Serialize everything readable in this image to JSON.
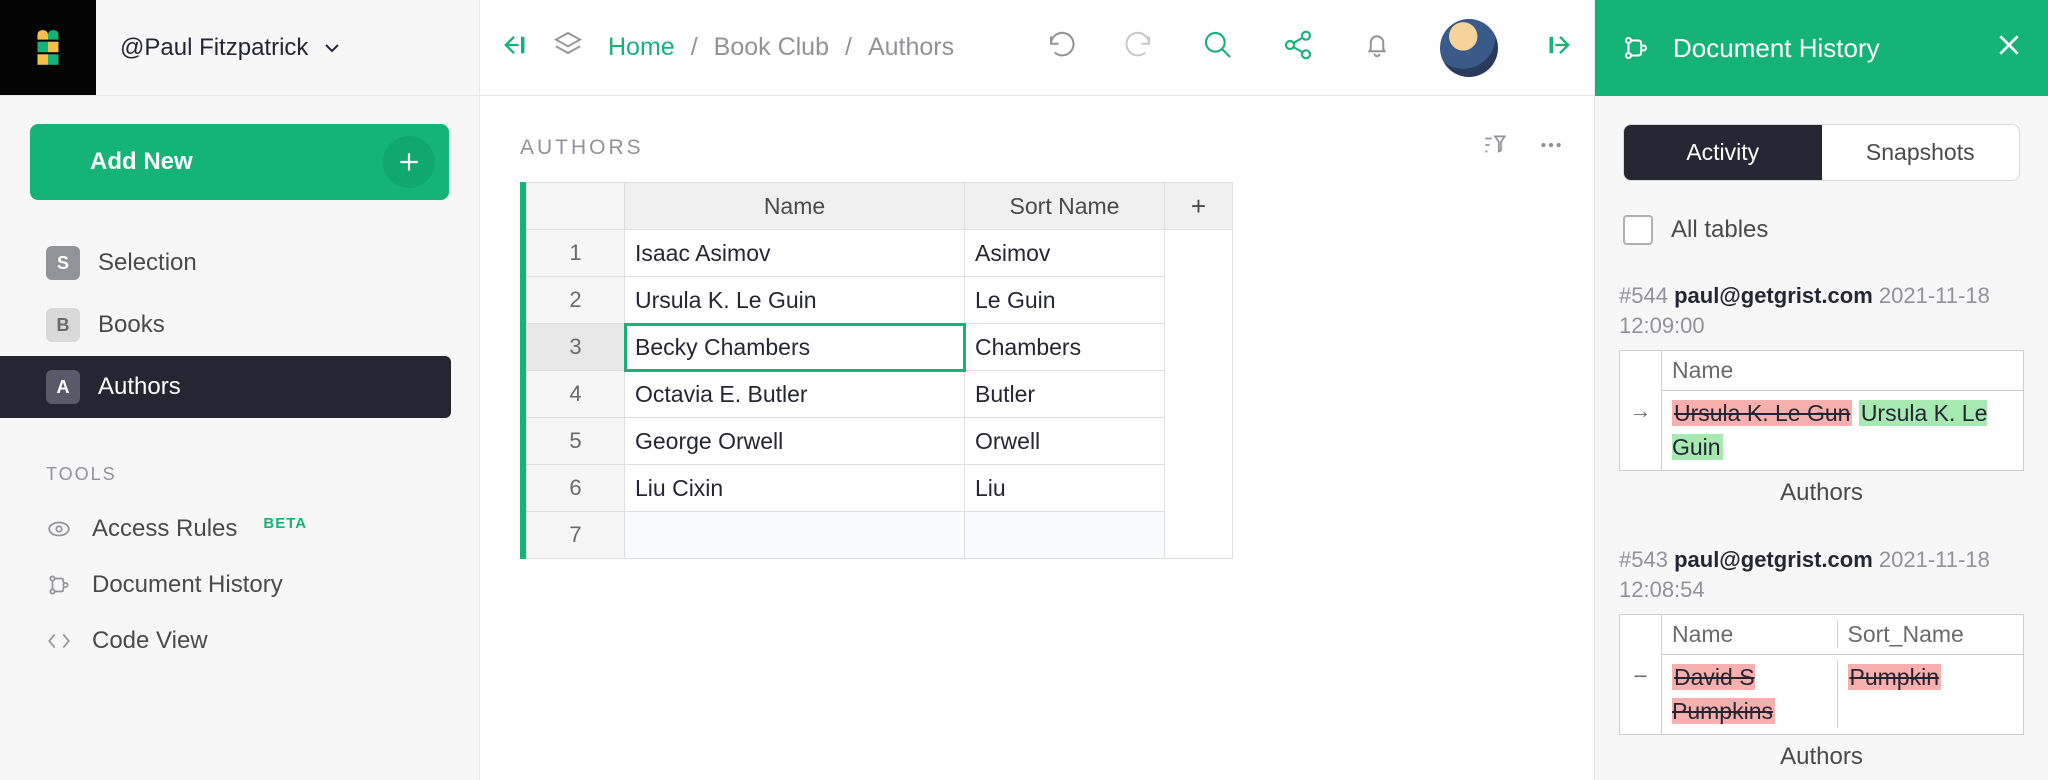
{
  "workspace": {
    "label": "@Paul Fitzpatrick"
  },
  "addNew": {
    "label": "Add New"
  },
  "pages": [
    {
      "letter": "S",
      "label": "Selection",
      "badge": "gray",
      "active": false
    },
    {
      "letter": "B",
      "label": "Books",
      "badge": "lgray",
      "active": false
    },
    {
      "letter": "A",
      "label": "Authors",
      "badge": "active",
      "active": true
    }
  ],
  "toolsHeader": "TOOLS",
  "tools": {
    "accessRules": {
      "label": "Access Rules",
      "beta": "BETA"
    },
    "documentHistory": {
      "label": "Document History"
    },
    "codeView": {
      "label": "Code View"
    }
  },
  "breadcrumb": {
    "home": "Home",
    "sep": "/",
    "crumb1": "Book Club",
    "crumb2": "Authors"
  },
  "view": {
    "title": "AUTHORS",
    "columns": {
      "name": "Name",
      "sort": "Sort Name",
      "add": "+"
    },
    "rows": [
      {
        "n": "1",
        "name": "Isaac Asimov",
        "sort": "Asimov"
      },
      {
        "n": "2",
        "name": "Ursula K. Le Guin",
        "sort": "Le Guin"
      },
      {
        "n": "3",
        "name": "Becky Chambers",
        "sort": "Chambers",
        "selected": true
      },
      {
        "n": "4",
        "name": "Octavia E. Butler",
        "sort": "Butler"
      },
      {
        "n": "5",
        "name": "George Orwell",
        "sort": "Orwell"
      },
      {
        "n": "6",
        "name": "Liu Cixin",
        "sort": "Liu"
      },
      {
        "n": "7",
        "name": "",
        "sort": "",
        "blank": true
      }
    ]
  },
  "rightPanel": {
    "title": "Document History",
    "tabs": {
      "activity": "Activity",
      "snapshots": "Snapshots"
    },
    "allTables": "All tables",
    "entries": [
      {
        "id": "#544",
        "user": "paul@getgrist.com",
        "time": "2021-11-18 12:09:00",
        "columns": [
          "Name"
        ],
        "icon": "→",
        "cells": [
          {
            "del": "Ursula K. Le Gun",
            "add": "Ursula K. Le Guin"
          }
        ],
        "table": "Authors"
      },
      {
        "id": "#543",
        "user": "paul@getgrist.com",
        "time": "2021-11-18 12:08:54",
        "columns": [
          "Name",
          "Sort_Name"
        ],
        "icon": "–",
        "cells": [
          {
            "del": "David S Pumpkins"
          },
          {
            "del": "Pumpkin"
          }
        ],
        "table": "Authors"
      }
    ]
  }
}
